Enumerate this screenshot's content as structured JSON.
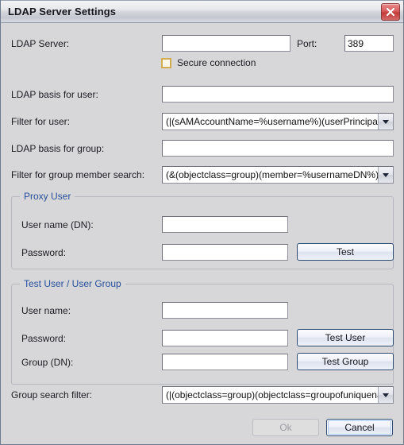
{
  "window": {
    "title": "LDAP Server Settings",
    "close_icon": "close-icon"
  },
  "fields": {
    "ldap_server": {
      "label": "LDAP Server:",
      "value": "",
      "placeholder": ""
    },
    "port": {
      "label": "Port:",
      "value": "389"
    },
    "secure_connection": {
      "label": "Secure connection",
      "checked": false
    },
    "ldap_basis_user": {
      "label": "LDAP basis for user:",
      "value": ""
    },
    "filter_user": {
      "label": "Filter for user:",
      "value": "(|(sAMAccountName=%username%)(userPrincipalName=%"
    },
    "ldap_basis_group": {
      "label": "LDAP basis for group:",
      "value": ""
    },
    "filter_group_member": {
      "label": "Filter for group member search:",
      "value": "(&(objectclass=group)(member=%usernameDN%))"
    },
    "group_search_filter": {
      "label": "Group search filter:",
      "value": "(|(objectclass=group)(objectclass=groupofuniquenames))"
    }
  },
  "proxy_user": {
    "legend": "Proxy User",
    "username_label": "User name (DN):",
    "username_value": "",
    "password_label": "Password:",
    "password_value": "",
    "test_button": "Test"
  },
  "test_user_group": {
    "legend": "Test User / User Group",
    "username_label": "User name:",
    "username_value": "",
    "password_label": "Password:",
    "password_value": "",
    "group_label": "Group (DN):",
    "group_value": "",
    "test_user_button": "Test User",
    "test_group_button": "Test Group"
  },
  "footer": {
    "ok_label": "Ok",
    "cancel_label": "Cancel"
  },
  "colors": {
    "dialog_bg": "#d7d7da",
    "legend_blue": "#27519b",
    "close_red": "#c23a3a",
    "checkbox_gold": "#d2ab4e"
  }
}
